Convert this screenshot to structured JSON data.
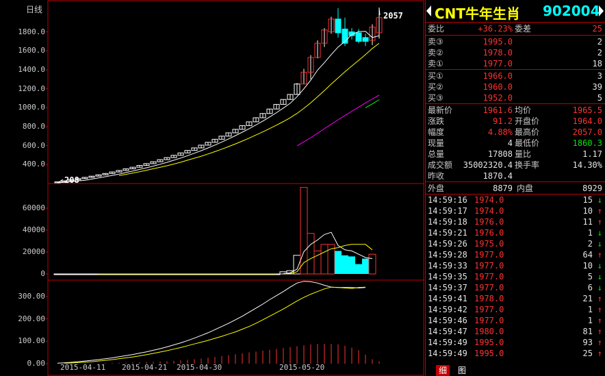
{
  "chart": {
    "period_label": "日线",
    "kline_y_labels": [
      "1800.0",
      "1600.0",
      "1400.0",
      "1200.0",
      "1000.0",
      "800.0",
      "600.0",
      "400.0"
    ],
    "kline_y_values": [
      1800,
      1600,
      1400,
      1200,
      1000,
      800,
      600,
      400
    ],
    "volume_y_labels": [
      "60000",
      "40000",
      "20000",
      "0"
    ],
    "volume_y_values": [
      60000,
      40000,
      20000,
      0
    ],
    "amount_y_labels": [
      "300.00",
      "200.00",
      "100.00",
      "0.00"
    ],
    "amount_y_values": [
      300,
      200,
      100,
      0
    ],
    "x_labels": [
      "2015-04-11",
      "2015-04-21",
      "2015-04-30",
      "2015-05-20"
    ],
    "x_label_index": [
      1,
      10,
      18,
      33
    ],
    "high_mark": "2057",
    "low_mark": "208",
    "colors": {
      "up": "#ff3232",
      "down": "#00ffff",
      "ma1": "#ffffff",
      "ma2": "#ffff00",
      "ma3": "#ff00ff",
      "ma4": "#00ff00",
      "frame": "#c00000"
    }
  },
  "chart_data": {
    "type": "candlestick",
    "kline_ylim": [
      200,
      2100
    ],
    "volume_ylim": [
      0,
      80000
    ],
    "amount_ylim": [
      0,
      370
    ],
    "opens": [
      208,
      218,
      229,
      240,
      252,
      265,
      278,
      292,
      306,
      322,
      338,
      355,
      372,
      391,
      410,
      430,
      452,
      474,
      498,
      523,
      549,
      576,
      605,
      635,
      667,
      700,
      735,
      772,
      811,
      851,
      894,
      939,
      986,
      1035,
      1087,
      1140,
      1250,
      1375,
      1530,
      1680,
      1800,
      1935,
      1830,
      1800,
      1790,
      1740,
      1710,
      1790
    ],
    "closes": [
      218,
      229,
      240,
      252,
      265,
      278,
      292,
      306,
      322,
      338,
      355,
      372,
      391,
      410,
      430,
      452,
      474,
      498,
      523,
      549,
      576,
      605,
      635,
      667,
      700,
      735,
      772,
      811,
      851,
      894,
      939,
      986,
      1035,
      1087,
      1140,
      1250,
      1375,
      1530,
      1680,
      1820,
      1935,
      1790,
      1680,
      1760,
      1700,
      1700,
      1850,
      1950
    ],
    "highs": [
      218,
      229,
      240,
      252,
      265,
      278,
      292,
      306,
      322,
      338,
      355,
      372,
      391,
      410,
      430,
      452,
      474,
      498,
      523,
      549,
      576,
      605,
      635,
      667,
      700,
      735,
      772,
      811,
      851,
      894,
      939,
      986,
      1035,
      1087,
      1140,
      1260,
      1410,
      1555,
      1710,
      1840,
      1960,
      2050,
      1950,
      1840,
      1830,
      1780,
      1880,
      2057
    ],
    "lows": [
      208,
      218,
      229,
      240,
      252,
      265,
      278,
      292,
      306,
      322,
      338,
      355,
      372,
      391,
      410,
      430,
      452,
      474,
      498,
      523,
      549,
      576,
      605,
      635,
      667,
      700,
      735,
      772,
      811,
      851,
      894,
      939,
      986,
      1035,
      1087,
      1140,
      1250,
      1300,
      1520,
      1640,
      1780,
      1740,
      1650,
      1720,
      1680,
      1650,
      1660,
      1730
    ],
    "ma5": [
      208,
      214,
      221,
      228,
      234,
      247,
      260,
      272,
      286,
      300,
      316,
      332,
      349,
      366,
      384,
      404,
      424,
      446,
      469,
      494,
      520,
      547,
      576,
      606,
      638,
      671,
      706,
      742,
      779,
      818,
      859,
      902,
      948,
      996,
      1047,
      1116,
      1200,
      1290,
      1396,
      1476,
      1560,
      1640,
      1700,
      1772,
      1803,
      1806,
      1740,
      1760
    ],
    "ma10": [
      null,
      null,
      null,
      null,
      null,
      null,
      null,
      null,
      null,
      284,
      297,
      311,
      325,
      340,
      356,
      372,
      388,
      406,
      425,
      446,
      467,
      488,
      512,
      537,
      563,
      590,
      618,
      648,
      679,
      712,
      745,
      780,
      816,
      854,
      894,
      940,
      994,
      1052,
      1116,
      1180,
      1250,
      1315,
      1380,
      1440,
      1500,
      1560,
      1625,
      1680
    ],
    "ma20": [
      null,
      null,
      null,
      null,
      null,
      null,
      null,
      null,
      null,
      null,
      null,
      null,
      null,
      null,
      null,
      null,
      null,
      null,
      null,
      null,
      null,
      null,
      null,
      null,
      null,
      null,
      null,
      null,
      null,
      null,
      null,
      null,
      null,
      null,
      null,
      598,
      640,
      684,
      730,
      778,
      826,
      872,
      918,
      962,
      1006,
      1050,
      1092,
      1132
    ],
    "ma60": [
      null,
      null,
      null,
      null,
      null,
      null,
      null,
      null,
      null,
      null,
      null,
      null,
      null,
      null,
      null,
      null,
      null,
      null,
      null,
      null,
      null,
      null,
      null,
      null,
      null,
      null,
      null,
      null,
      null,
      null,
      null,
      null,
      null,
      null,
      null,
      null,
      null,
      null,
      null,
      null,
      null,
      null,
      null,
      null,
      null,
      1000,
      1040,
      1085
    ],
    "volumes": [
      10,
      10,
      10,
      10,
      10,
      10,
      10,
      10,
      10,
      10,
      10,
      10,
      10,
      10,
      10,
      10,
      10,
      10,
      10,
      10,
      10,
      10,
      10,
      10,
      10,
      10,
      10,
      10,
      10,
      10,
      10,
      10,
      10,
      2000,
      3000,
      17000,
      79000,
      37000,
      21000,
      27000,
      27000,
      21000,
      17000,
      16000,
      9000,
      14000,
      18000,
      null
    ],
    "volume_ma1": [
      null,
      null,
      null,
      null,
      null,
      null,
      null,
      null,
      null,
      null,
      null,
      null,
      null,
      null,
      null,
      null,
      null,
      null,
      null,
      null,
      null,
      null,
      null,
      null,
      null,
      null,
      null,
      null,
      null,
      null,
      null,
      null,
      null,
      400,
      1000,
      4400,
      20300,
      27000,
      31000,
      36000,
      38000,
      26000,
      22000,
      21000,
      18000,
      15000,
      14000,
      null
    ],
    "volume_ma2": [
      null,
      null,
      null,
      null,
      null,
      null,
      null,
      null,
      null,
      null,
      null,
      null,
      null,
      null,
      null,
      null,
      null,
      null,
      null,
      null,
      null,
      null,
      null,
      null,
      null,
      null,
      null,
      null,
      null,
      null,
      null,
      null,
      null,
      200,
      500,
      2000,
      10400,
      14000,
      17000,
      20000,
      23000,
      24000,
      26000,
      27000,
      27000,
      27000,
      22000,
      null
    ],
    "amounts": [
      1,
      1,
      1,
      1,
      2,
      2,
      2,
      3,
      3,
      4,
      4,
      5,
      6,
      7,
      8,
      10,
      11,
      13,
      15,
      18,
      20,
      23,
      27,
      30,
      34,
      38,
      42,
      46,
      50,
      54,
      58,
      62,
      66,
      70,
      74,
      78,
      82,
      86,
      88,
      88,
      88,
      86,
      80,
      72,
      60,
      40,
      20,
      10
    ],
    "amount_ma1": [
      2,
      4,
      6,
      9,
      12,
      15,
      18,
      22,
      26,
      31,
      36,
      41,
      47,
      53,
      60,
      67,
      75,
      84,
      93,
      103,
      114,
      126,
      138,
      152,
      166,
      180,
      196,
      212,
      230,
      248,
      266,
      286,
      304,
      322,
      342,
      360,
      368,
      366,
      360,
      350,
      342,
      340,
      340,
      340,
      338,
      340,
      null,
      null
    ],
    "amount_ma2": [
      null,
      2,
      3,
      5,
      7,
      9,
      12,
      15,
      18,
      22,
      26,
      30,
      35,
      40,
      46,
      52,
      58,
      65,
      72,
      80,
      88,
      96,
      104,
      113,
      122,
      132,
      142,
      154,
      166,
      180,
      196,
      212,
      228,
      244,
      262,
      280,
      296,
      310,
      322,
      334,
      342,
      340,
      338,
      336,
      340,
      342,
      null,
      null
    ]
  },
  "quote": {
    "stock_name": "CNT牛年生肖",
    "stock_code": "902004",
    "weibi_label": "委比",
    "weibi_value": "+36.23%",
    "weicha_label": "委差",
    "weicha_value": "25",
    "asks": [
      {
        "label": "卖③",
        "price": "1995.0",
        "volume": "2"
      },
      {
        "label": "卖②",
        "price": "1978.0",
        "volume": "2"
      },
      {
        "label": "卖①",
        "price": "1977.0",
        "volume": "18"
      }
    ],
    "bids": [
      {
        "label": "买①",
        "price": "1966.0",
        "volume": "3"
      },
      {
        "label": "买②",
        "price": "1960.0",
        "volume": "39"
      },
      {
        "label": "买③",
        "price": "1952.0",
        "volume": "5"
      }
    ],
    "stats": [
      {
        "l1": "最新价",
        "v1": "1961.6",
        "l2": "均价",
        "v2": "1965.5",
        "c1": "red",
        "c2": "red"
      },
      {
        "l1": "涨跌",
        "v1": "91.2",
        "l2": "开盘价",
        "v2": "1964.0",
        "c1": "red",
        "c2": "red"
      },
      {
        "l1": "幅度",
        "v1": "4.88%",
        "l2": "最高价",
        "v2": "2057.0",
        "c1": "red",
        "c2": "red"
      },
      {
        "l1": "现量",
        "v1": "4",
        "l2": "最低价",
        "v2": "1860.3",
        "c1": "white",
        "c2": "green"
      },
      {
        "l1": "总量",
        "v1": "17808",
        "l2": "量比",
        "v2": "1.17",
        "c1": "white",
        "c2": "white"
      },
      {
        "l1": "成交额",
        "v1": "35002320.4",
        "l2": "换手率",
        "v2": "14.30%",
        "c1": "white",
        "c2": "white"
      }
    ],
    "prev_close_label": "昨收",
    "prev_close_value": "1870.4",
    "outer_label": "外盘",
    "outer_value": "8879",
    "inner_label": "内盘",
    "inner_value": "8929",
    "ticks": [
      {
        "time": "14:59:16",
        "price": "1974.0",
        "vol": "15",
        "dir": "down"
      },
      {
        "time": "14:59:17",
        "price": "1974.0",
        "vol": "10",
        "dir": "up"
      },
      {
        "time": "14:59:18",
        "price": "1976.0",
        "vol": "11",
        "dir": "up"
      },
      {
        "time": "14:59:21",
        "price": "1976.0",
        "vol": "1",
        "dir": "down"
      },
      {
        "time": "14:59:26",
        "price": "1975.0",
        "vol": "2",
        "dir": "down"
      },
      {
        "time": "14:59:28",
        "price": "1977.0",
        "vol": "64",
        "dir": "up"
      },
      {
        "time": "14:59:33",
        "price": "1977.0",
        "vol": "10",
        "dir": "down"
      },
      {
        "time": "14:59:35",
        "price": "1977.0",
        "vol": "5",
        "dir": "down"
      },
      {
        "time": "14:59:37",
        "price": "1977.0",
        "vol": "6",
        "dir": "down"
      },
      {
        "time": "14:59:41",
        "price": "1978.0",
        "vol": "21",
        "dir": "up"
      },
      {
        "time": "14:59:42",
        "price": "1977.0",
        "vol": "1",
        "dir": "up"
      },
      {
        "time": "14:59:46",
        "price": "1977.0",
        "vol": "1",
        "dir": "up"
      },
      {
        "time": "14:59:47",
        "price": "1980.0",
        "vol": "81",
        "dir": "up"
      },
      {
        "time": "14:59:49",
        "price": "1995.0",
        "vol": "93",
        "dir": "up"
      },
      {
        "time": "14:59:49",
        "price": "1995.0",
        "vol": "25",
        "dir": "up"
      }
    ],
    "tabs": [
      "细",
      "图"
    ]
  }
}
